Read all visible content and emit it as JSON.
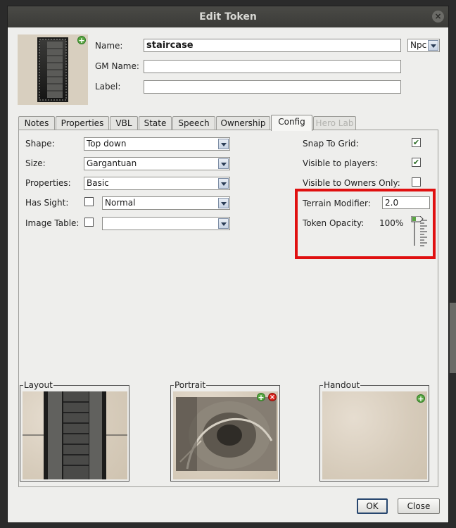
{
  "window": {
    "title": "Edit Token",
    "close_glyph": "×"
  },
  "header": {
    "name_label": "Name:",
    "name_value": "staircase",
    "type_value": "Npc",
    "gm_name_label": "GM Name:",
    "gm_name_value": "",
    "label_label": "Label:",
    "label_value": ""
  },
  "tabs": [
    {
      "label": "Notes"
    },
    {
      "label": "Properties"
    },
    {
      "label": "VBL"
    },
    {
      "label": "State"
    },
    {
      "label": "Speech"
    },
    {
      "label": "Ownership"
    },
    {
      "label": "Config",
      "active": true
    },
    {
      "label": "Hero Lab",
      "disabled": true
    }
  ],
  "config": {
    "shape_label": "Shape:",
    "shape_value": "Top down",
    "size_label": "Size:",
    "size_value": "Gargantuan",
    "properties_label": "Properties:",
    "properties_value": "Basic",
    "has_sight_label": "Has Sight:",
    "has_sight_checked": false,
    "sight_value": "Normal",
    "image_table_label": "Image Table:",
    "image_table_checked": false,
    "image_table_value": "",
    "snap_label": "Snap To Grid:",
    "snap_checked": true,
    "visible_label": "Visible to players:",
    "visible_checked": true,
    "owners_only_label": "Visible to Owners Only:",
    "owners_only_checked": false,
    "terrain_label": "Terrain Modifier:",
    "terrain_value": "2.0",
    "opacity_label": "Token Opacity:",
    "opacity_value": "100%",
    "opacity_fraction": 1.0
  },
  "images": {
    "layout_label": "Layout",
    "portrait_label": "Portrait",
    "handout_label": "Handout"
  },
  "buttons": {
    "ok": "OK",
    "close": "Close"
  },
  "icons": {
    "add": "+",
    "remove": "×",
    "check": "✔"
  },
  "colors": {
    "highlight": "#e01010",
    "add_icon": "#5aa643",
    "remove_icon": "#d9231b"
  }
}
